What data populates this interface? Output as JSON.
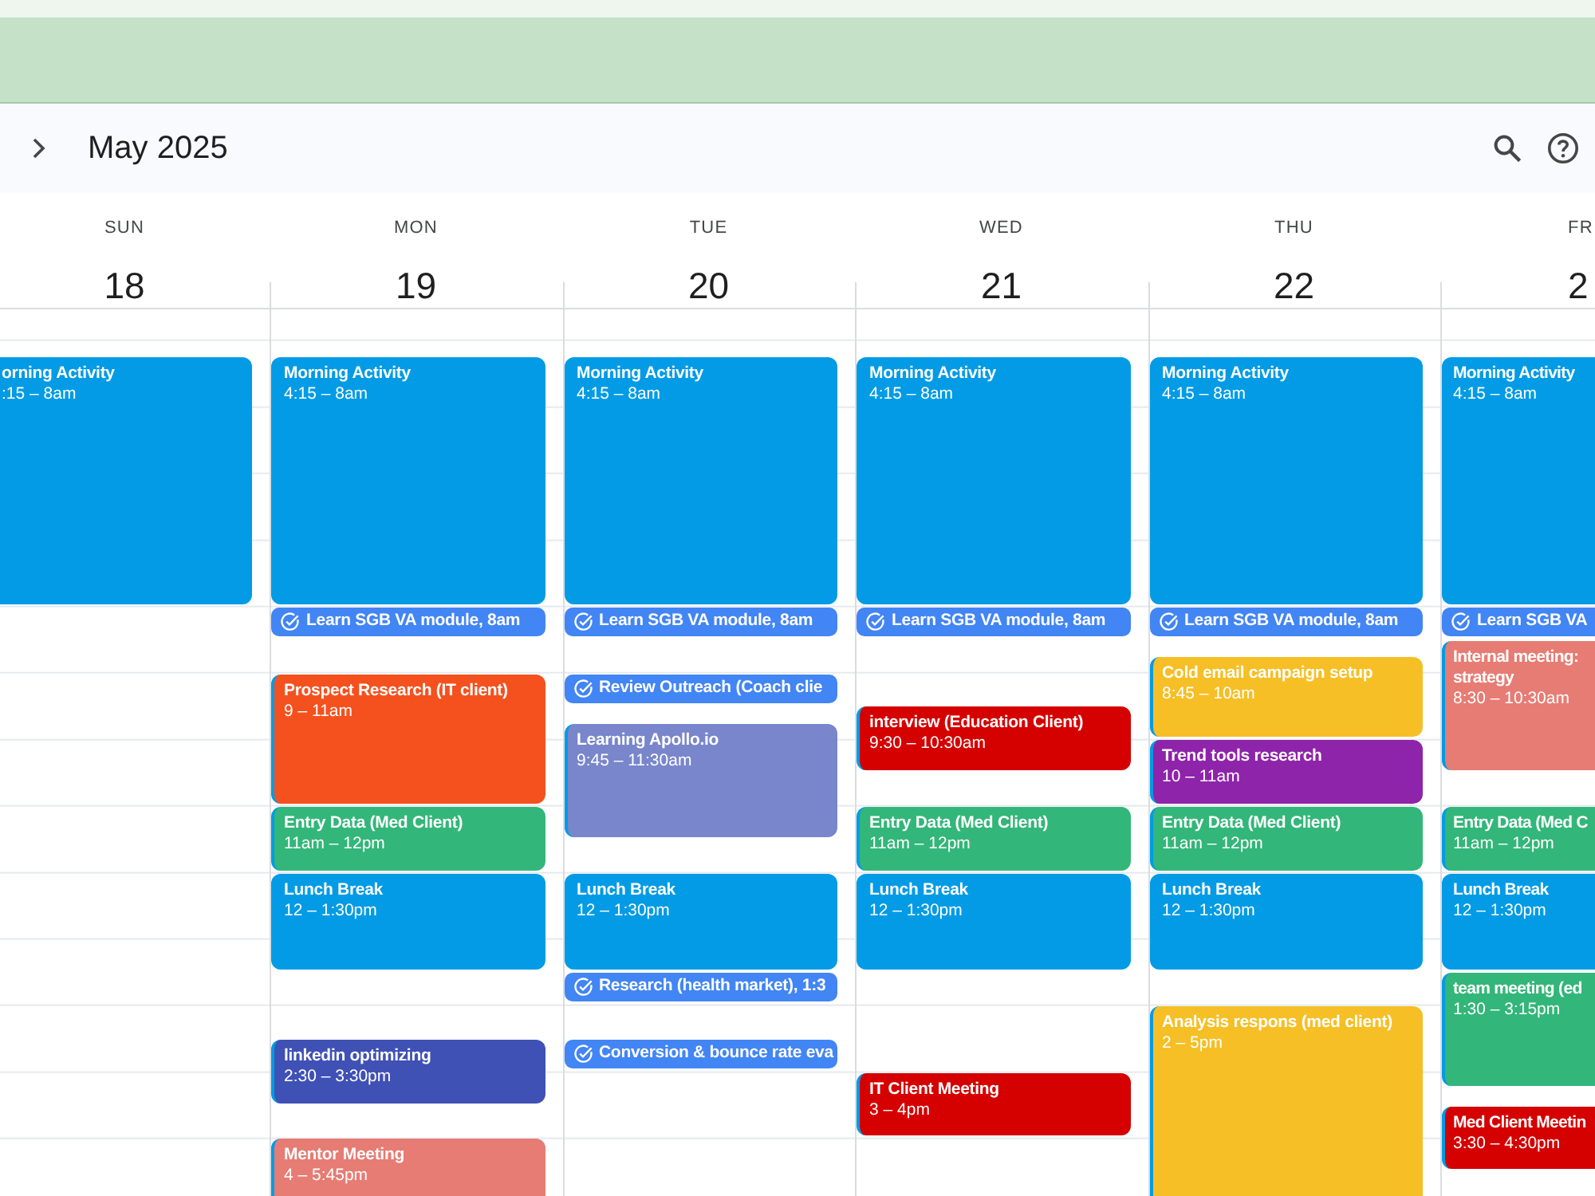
{
  "toolbar": {
    "title": "May 2025"
  },
  "days": [
    {
      "weekday": "SUN",
      "date": "18",
      "events": [
        {
          "kind": "event",
          "title": "orning Activity",
          "time": ":15 – 8am",
          "color": "#039be5"
        }
      ]
    },
    {
      "weekday": "MON",
      "date": "19",
      "events": [
        {
          "kind": "event",
          "title": "Morning Activity",
          "time": "4:15 – 8am",
          "color": "#039be5"
        },
        {
          "kind": "task",
          "title": "Learn SGB VA module, 8am"
        },
        {
          "kind": "event",
          "title": "Prospect Research (IT client)",
          "time": "9 – 11am",
          "color": "#f4511e"
        },
        {
          "kind": "event",
          "title": "Entry Data (Med Client)",
          "time": "11am – 12pm",
          "color": "#33b679"
        },
        {
          "kind": "event",
          "title": "Lunch Break",
          "time": "12 – 1:30pm",
          "color": "#039be5"
        },
        {
          "kind": "event",
          "title": "linkedin optimizing",
          "time": "2:30 – 3:30pm",
          "color": "#3f51b5"
        },
        {
          "kind": "event",
          "title": "Mentor Meeting",
          "time": "4 – 5:45pm",
          "color": "#e67c73"
        }
      ]
    },
    {
      "weekday": "TUE",
      "date": "20",
      "events": [
        {
          "kind": "event",
          "title": "Morning Activity",
          "time": "4:15 – 8am",
          "color": "#039be5"
        },
        {
          "kind": "task",
          "title": "Learn SGB VA module, 8am"
        },
        {
          "kind": "task",
          "title": "Review Outreach (Coach clie"
        },
        {
          "kind": "event",
          "title": "Learning Apollo.io",
          "time": "9:45 – 11:30am",
          "color": "#7986cb"
        },
        {
          "kind": "event",
          "title": "Lunch Break",
          "time": "12 – 1:30pm",
          "color": "#039be5"
        },
        {
          "kind": "task",
          "title": "Research (health market), 1:3"
        },
        {
          "kind": "task",
          "title": "Conversion & bounce rate eva"
        }
      ]
    },
    {
      "weekday": "WED",
      "date": "21",
      "events": [
        {
          "kind": "event",
          "title": "Morning Activity",
          "time": "4:15 – 8am",
          "color": "#039be5"
        },
        {
          "kind": "task",
          "title": "Learn SGB VA module, 8am"
        },
        {
          "kind": "event",
          "title": "interview (Education Client)",
          "time": "9:30 – 10:30am",
          "color": "#d50000"
        },
        {
          "kind": "event",
          "title": "Entry Data (Med Client)",
          "time": "11am – 12pm",
          "color": "#33b679"
        },
        {
          "kind": "event",
          "title": "Lunch Break",
          "time": "12 – 1:30pm",
          "color": "#039be5"
        },
        {
          "kind": "event",
          "title": "IT Client Meeting",
          "time": "3 – 4pm",
          "color": "#d50000"
        }
      ]
    },
    {
      "weekday": "THU",
      "date": "22",
      "events": [
        {
          "kind": "event",
          "title": "Morning Activity",
          "time": "4:15 – 8am",
          "color": "#039be5"
        },
        {
          "kind": "task",
          "title": "Learn SGB VA module, 8am"
        },
        {
          "kind": "event",
          "title": "Cold email campaign setup",
          "time": "8:45 – 10am",
          "color": "#f6bf26"
        },
        {
          "kind": "event",
          "title": "Trend tools research",
          "time": "10 – 11am",
          "color": "#8e24aa"
        },
        {
          "kind": "event",
          "title": "Entry Data (Med Client)",
          "time": "11am – 12pm",
          "color": "#33b679"
        },
        {
          "kind": "event",
          "title": "Lunch Break",
          "time": "12 – 1:30pm",
          "color": "#039be5"
        },
        {
          "kind": "event",
          "title": "Analysis respons (med client)",
          "time": "2 – 5pm",
          "color": "#f6bf26"
        }
      ]
    },
    {
      "weekday": "FR",
      "date": "2",
      "events": [
        {
          "kind": "event",
          "title": "Morning Activity",
          "time": "4:15 – 8am",
          "color": "#039be5"
        },
        {
          "kind": "task",
          "title": "Learn SGB VA"
        },
        {
          "kind": "event",
          "title": "Internal meeting: strategy",
          "time": "8:30 – 10:30am",
          "color": "#e67c73"
        },
        {
          "kind": "event",
          "title": "Entry Data (Med C",
          "time": "11am – 12pm",
          "color": "#33b679"
        },
        {
          "kind": "event",
          "title": "Lunch Break",
          "time": "12 – 1:30pm",
          "color": "#039be5"
        },
        {
          "kind": "event",
          "title": "team meeting (ed",
          "time": "1:30 – 3:15pm",
          "color": "#33b679"
        },
        {
          "kind": "event",
          "title": "Med Client Meetin",
          "time": "3:30 – 4:30pm",
          "color": "#d50000"
        }
      ]
    }
  ]
}
